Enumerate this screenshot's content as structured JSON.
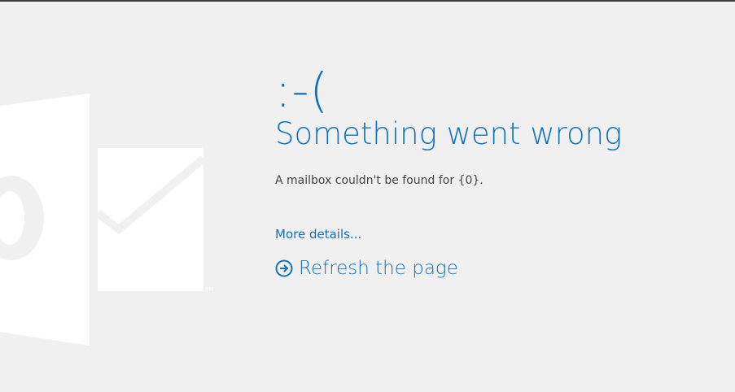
{
  "error_page": {
    "emoticon": ":-(",
    "title": "Something went wrong",
    "message": "A mailbox couldn't be found for {0}.",
    "more_details_label": "More details...",
    "refresh_label": "Refresh the page"
  },
  "background_logo": {
    "icon": "outlook-logo-icon",
    "trademark": "TM"
  },
  "colors": {
    "background": "#f0f0f0",
    "accent": "#0f72c4",
    "text": "#444444",
    "logo": "#ffffff"
  }
}
